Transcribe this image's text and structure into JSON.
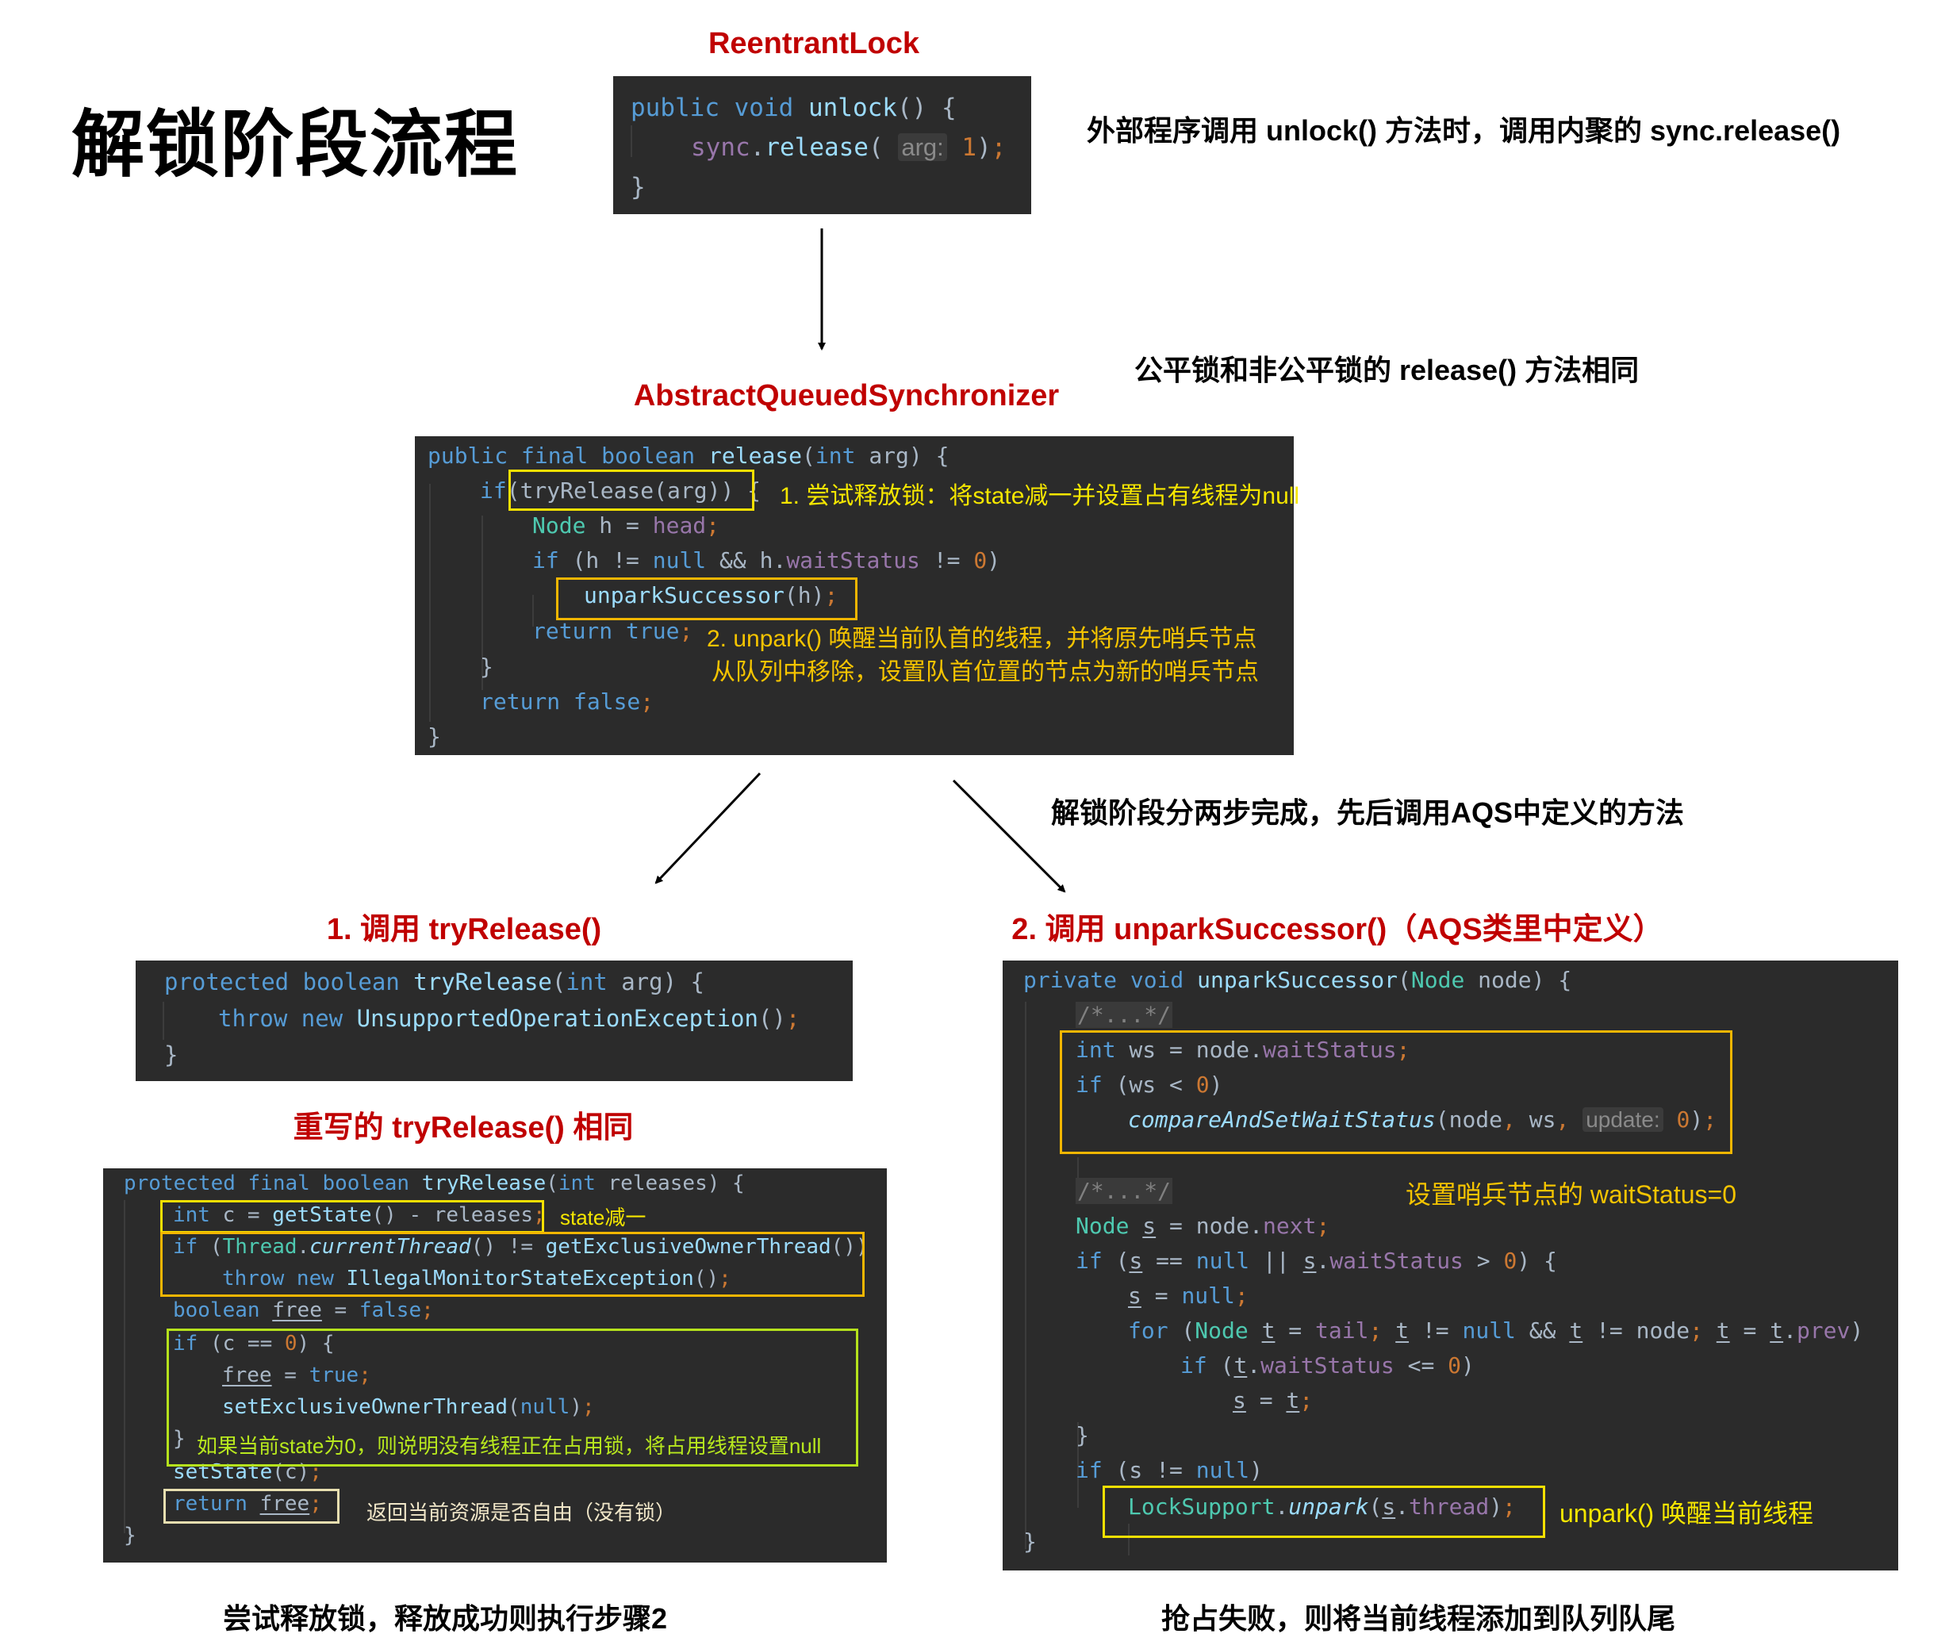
{
  "title": "解锁阶段流程",
  "sections": {
    "reentrant": {
      "title": "ReentrantLock",
      "note": "外部程序调用 unlock() 方法时，调用内聚的 sync.release()",
      "code": {
        "l1": {
          "kw": "public void ",
          "fn": "unlock",
          "rest": "() {"
        },
        "l2": {
          "obj": "sync",
          "dot": ".",
          "fn": "release",
          "open": "(",
          "hint": "arg:",
          "num": "1",
          "close": ")",
          "semi": ";"
        },
        "l3": "}"
      }
    },
    "aqs": {
      "title": "AbstractQueuedSynchronizer",
      "note": "公平锁和非公平锁的 release() 方法相同",
      "code": {
        "l1": {
          "kw": "public final boolean ",
          "fn": "release",
          "p1": "(",
          "kw2": "int",
          "rest": " arg) {"
        },
        "l2": {
          "kw": "if",
          "expr": "(tryRelease(arg))",
          "rest": " {"
        },
        "l3": {
          "ty": "Node",
          "rest": " h = ",
          "fld": "head",
          "semi": ";"
        },
        "l4": {
          "kw": "if",
          "p": " (h != ",
          "kw2": "null",
          "p2": " && h.",
          "fld": "waitStatus",
          "p3": " != ",
          "num": "0",
          "p4": ")"
        },
        "l5": {
          "fn": "unparkSuccessor",
          "rest": "(h)",
          "semi": ";"
        },
        "l6": {
          "kw": "return true",
          "semi": ";"
        },
        "l7": "}",
        "l8": {
          "kw": "return false",
          "semi": ";"
        },
        "l9": "}"
      },
      "annotations": {
        "a1": "1. 尝试释放锁：将state减一并设置占有线程为null",
        "a2_line1": "2. unpark() 唤醒当前队首的线程，并将原先哨兵节点",
        "a2_line2": "从队列中移除，设置队首位置的节点为新的哨兵节点"
      }
    },
    "middle_note": "解锁阶段分两步完成，先后调用AQS中定义的方法",
    "step1": {
      "title": "1. 调用 tryRelease()",
      "base_code": {
        "l1": {
          "kw": "protected boolean ",
          "fn": "tryRelease",
          "p": "(",
          "kw2": "int",
          "rest": " arg) {"
        },
        "l2": {
          "kw": "throw new ",
          "fn": "UnsupportedOperationException",
          "rest": "()",
          "semi": ";"
        },
        "l3": "}"
      },
      "override_title": "重写的 tryRelease() 相同",
      "override_code": {
        "l1": {
          "kw": "protected final boolean ",
          "fn": "tryRelease",
          "p": "(",
          "kw2": "int",
          "rest": " releases) {"
        },
        "l2": {
          "kw": "int",
          "p": " c = ",
          "fn": "getState",
          "rest": "() - releases",
          "semi": ";"
        },
        "l3": {
          "kw": "if",
          "p": " (",
          "ty": "Thread",
          "dot": ".",
          "fn": "currentThread",
          "p2": "() != ",
          "fn2": "getExclusiveOwnerThread",
          "p3": "())"
        },
        "l4": {
          "kw": "throw new ",
          "fn": "IllegalMonitorStateException",
          "rest": "()",
          "semi": ";"
        },
        "l5": {
          "kw": "boolean ",
          "var": "free",
          "p": " = ",
          "kw2": "false",
          "semi": ";"
        },
        "l6": {
          "kw": "if",
          "p": " (c == ",
          "num": "0",
          "p2": ") {"
        },
        "l7": {
          "var": "free",
          "p": " = ",
          "kw": "true",
          "semi": ";"
        },
        "l8": {
          "fn": "setExclusiveOwnerThread",
          "p": "(",
          "kw": "null",
          "p2": ")",
          "semi": ";"
        },
        "l9": "}",
        "l10": {
          "fn": "setState",
          "p": "(c)",
          "semi": ";"
        },
        "l11": {
          "kw": "return ",
          "var": "free",
          "semi": ";"
        },
        "l12": "}"
      },
      "annotations": {
        "state": "state减一",
        "zero": "如果当前state为0，则说明没有线程正在占用锁，将占用线程设置null",
        "ret": "返回当前资源是否自由（没有锁）"
      },
      "footer": "尝试释放锁，释放成功则执行步骤2"
    },
    "step2": {
      "title": "2. 调用 unparkSuccessor()（AQS类里中定义）",
      "code": {
        "l1": {
          "kw": "private void ",
          "fn": "unparkSuccessor",
          "p": "(",
          "ty": "Node",
          "rest": " node) {"
        },
        "fold": "/*...*/",
        "l2": {
          "kw": "int",
          "p": " ws = node.",
          "fld": "waitStatus",
          "semi": ";"
        },
        "l3": {
          "kw": "if",
          "p": " (ws < ",
          "num": "0",
          "p2": ")"
        },
        "l4": {
          "fn": "compareAndSetWaitStatus",
          "p": "(node",
          "c1": ",",
          "p2": " ws",
          "c2": ",",
          "hint": "update:",
          "num": "0",
          "p3": ")",
          "semi": ";"
        },
        "l5": {
          "ty": "Node",
          "var": "s",
          "p": " = node.",
          "fld": "next",
          "semi": ";"
        },
        "l6": {
          "kw": "if",
          "p": " (",
          "var": "s",
          "p2": " == ",
          "kw2": "null",
          "p3": " || ",
          "var2": "s",
          "dot": ".",
          "fld": "waitStatus",
          "p4": " > ",
          "num": "0",
          "p5": ") {"
        },
        "l7": {
          "var": "s",
          "p": " = ",
          "kw": "null",
          "semi": ";"
        },
        "l8": {
          "kw": "for",
          "p": " (",
          "ty": "Node",
          "var": "t",
          "p2": " = ",
          "fld": "tail",
          "semi": ";",
          "var2": "t",
          "p3": " != ",
          "kw2": "null",
          "p4": " && ",
          "var3": "t",
          "p5": " != node",
          "var4": "t",
          "p6": " = ",
          "var5": "t",
          "dot": ".",
          "fld2": "prev",
          "p7": ")"
        },
        "l9": {
          "kw": "if",
          "p": " (",
          "var": "t",
          "dot": ".",
          "fld": "waitStatus",
          "p2": " <= ",
          "num": "0",
          "p3": ")"
        },
        "l10": {
          "var": "s",
          "p": " = ",
          "var2": "t",
          "semi": ";"
        },
        "l11": "}",
        "l12": {
          "kw": "if",
          "p": " (s != ",
          "kw2": "null",
          "p2": ")"
        },
        "l13": {
          "ty": "LockSupport",
          "dot": ".",
          "fn": "unpark",
          "p": "(",
          "var": "s",
          "dot2": ".",
          "fld": "thread",
          "p2": ")",
          "semi": ";"
        },
        "l14": "}"
      },
      "annotations": {
        "ws": "设置哨兵节点的 waitStatus=0",
        "unpark": "unpark() 唤醒当前线程"
      },
      "footer": "抢占失败，则将当前线程添加到队列队尾"
    }
  },
  "colors": {
    "title_red": "#c00000",
    "code_bg": "#2b2b2b",
    "highlight_yellow": "#f5e000",
    "highlight_orange": "#f2b600",
    "highlight_green": "#b5e21c"
  }
}
